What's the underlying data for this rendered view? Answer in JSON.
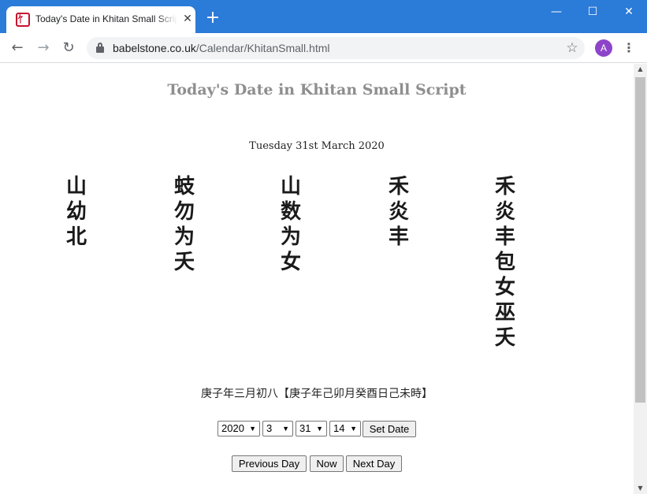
{
  "browser": {
    "tab_title": "Today's Date in Khitan Small Script",
    "tab_favicon": "𖿰",
    "close_glyph": "✕",
    "new_tab_glyph": "+",
    "window_controls": {
      "minimize": "—",
      "maximize": "☐",
      "close": "✕"
    },
    "url_host": "babelstone.co.uk",
    "url_path": "/Calendar/KhitanSmall.html",
    "profile_initial": "A",
    "nav_icons": {
      "back": "←",
      "forward": "→",
      "reload": "↻",
      "star": "☆",
      "menu": "⋮"
    },
    "colors": {
      "titlebar": "#2b7bd8",
      "avatar": "#8e44c9"
    }
  },
  "page": {
    "title": "Today's Date in Khitan Small Script",
    "gregorian_date": "Tuesday 31st March 2020",
    "khitan_columns": [
      [
        "山",
        "幼",
        "北"
      ],
      [
        "蚑",
        "勿",
        "为",
        "夭"
      ],
      [
        "山",
        "数",
        "为",
        "女"
      ],
      [
        "禾",
        "炎",
        "丰"
      ],
      [
        "禾",
        "炎",
        "丰",
        "包",
        "女",
        "巫",
        "夭"
      ]
    ],
    "chinese_date": "庚子年三月初八【庚子年己卯月癸酉日己未時】",
    "controls": {
      "year_value": "2020",
      "month_value": "3",
      "day_value": "31",
      "hour_value": "14",
      "dropdown_arrow": "▼",
      "set_date_label": "Set Date",
      "previous_day_label": "Previous Day",
      "now_label": "Now",
      "next_day_label": "Next Day"
    },
    "scroll_arrows": {
      "up": "▲",
      "down": "▼"
    }
  }
}
